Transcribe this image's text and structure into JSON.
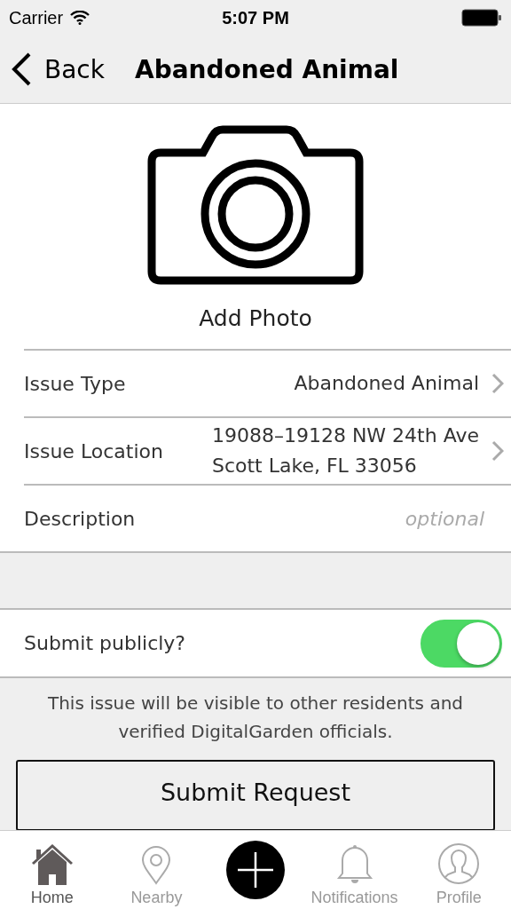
{
  "status_bar": {
    "carrier": "Carrier",
    "time": "5:07 PM"
  },
  "nav": {
    "back": "Back",
    "title": "Abandoned Animal"
  },
  "photo": {
    "label": "Add Photo"
  },
  "form_rows": [
    {
      "kind": "select",
      "label": "Issue Type",
      "value_lines": [
        "Abandoned Animal"
      ]
    },
    {
      "kind": "select",
      "label": "Issue Location",
      "value_lines": [
        "19088–19128 NW 24th Ave",
        "Scott Lake, FL 33056"
      ]
    },
    {
      "kind": "input",
      "label": "Description",
      "placeholder": "optional"
    }
  ],
  "public_toggle": {
    "label": "Submit publicly?",
    "on": true
  },
  "note": "This issue will be visible to other residents and verified DigitalGarden officials.",
  "submit_button": "Submit Request",
  "tabs": [
    {
      "kind": "home",
      "label": "Home",
      "selected": true
    },
    {
      "kind": "nearby",
      "label": "Nearby",
      "selected": false
    },
    {
      "kind": "add",
      "selected": false
    },
    {
      "kind": "notifications",
      "label": "Notifications",
      "selected": false
    },
    {
      "kind": "profile",
      "label": "Profile",
      "selected": false
    }
  ]
}
